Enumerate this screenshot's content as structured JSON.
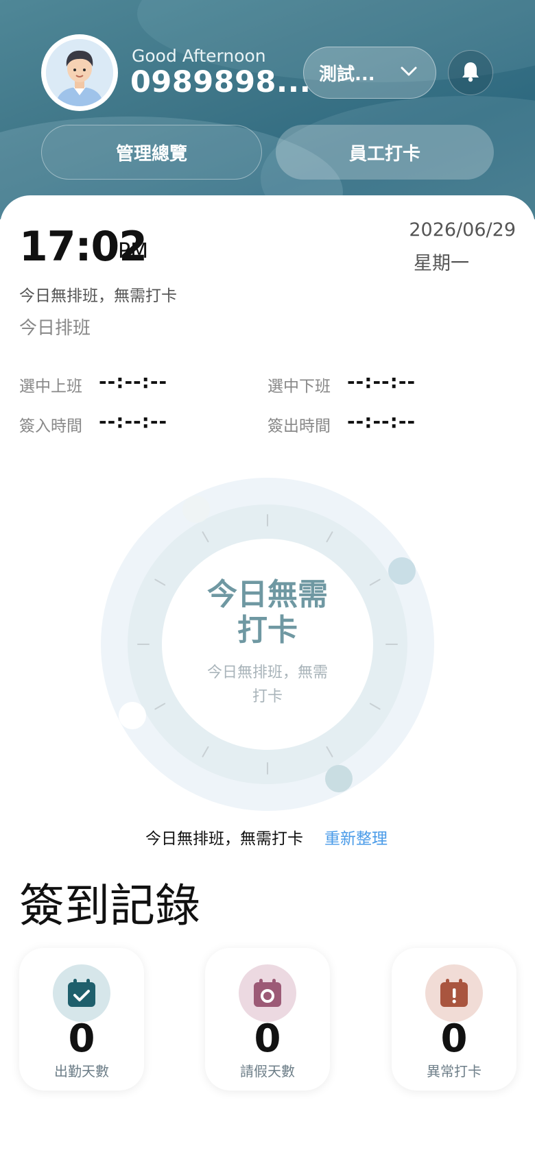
{
  "header": {
    "greeting": "Good Afternoon",
    "username": "0989898...",
    "company": "測試...",
    "tabs": [
      {
        "label": "管理總覽"
      },
      {
        "label": "員工打卡"
      }
    ]
  },
  "clock": {
    "time": "17:02",
    "ampm": "PM",
    "date": "2026/06/29",
    "weekday": "星期一",
    "notice": "今日無排班，無需打卡",
    "schedule_title": "今日排班"
  },
  "times": {
    "shift_start_label": "選中上班",
    "shift_start_value": "--:--:--",
    "shift_end_label": "選中下班",
    "shift_end_value": "--:--:--",
    "check_in_label": "簽入時間",
    "check_in_value": "--:--:--",
    "check_out_label": "簽出時間",
    "check_out_value": "--:--:--"
  },
  "dial": {
    "title_line1": "今日無需",
    "title_line2": "打卡",
    "sub_line1": "今日無排班，無需",
    "sub_line2": "打卡"
  },
  "status": {
    "text": "今日無排班，無需打卡",
    "refresh": "重新整理"
  },
  "records": {
    "title": "簽到記錄",
    "stats": [
      {
        "value": "0",
        "label": "出勤天數",
        "icon": "calendar-check-icon",
        "color": "#1f5f6c",
        "bg": "#d6e6ea"
      },
      {
        "value": "0",
        "label": "請假天數",
        "icon": "calendar-circle-icon",
        "color": "#9c5a76",
        "bg": "#ecd9e1"
      },
      {
        "value": "0",
        "label": "異常打卡",
        "icon": "calendar-alert-icon",
        "color": "#a9553f",
        "bg": "#f1dcd6"
      }
    ]
  }
}
